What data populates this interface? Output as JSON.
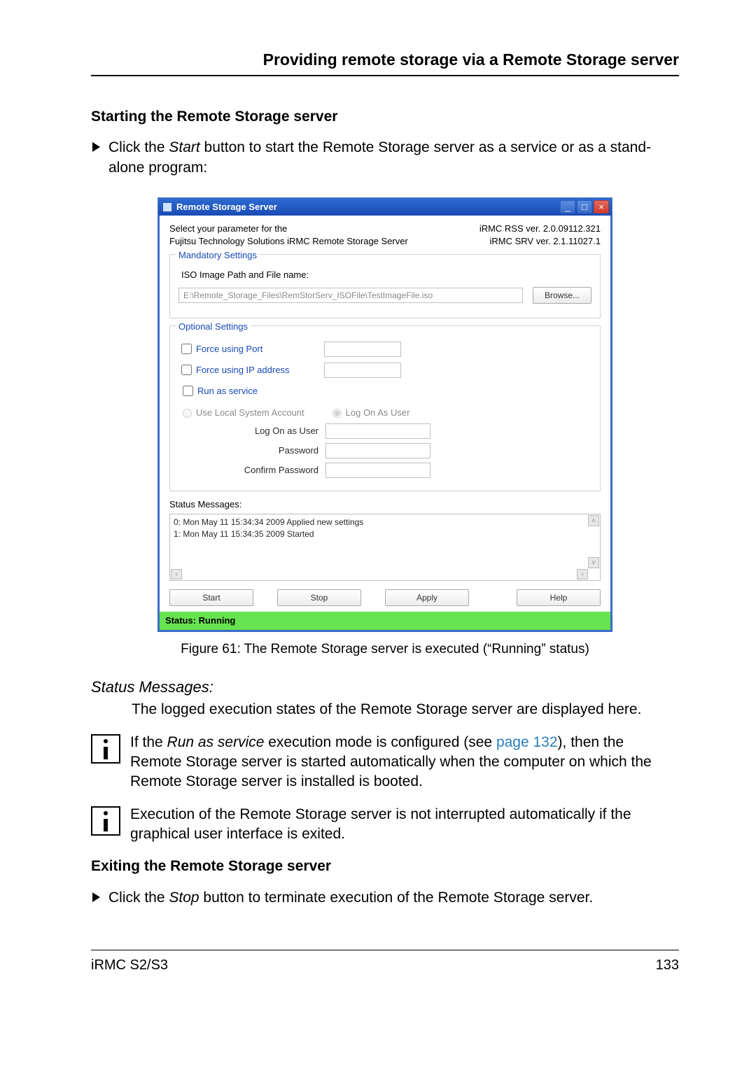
{
  "page": {
    "header": "Providing remote storage via a Remote Storage server",
    "section_start_title": "Starting the Remote Storage server",
    "step_start_prefix": "Click the ",
    "step_start_button": "Start",
    "step_start_suffix": " button to start the Remote Storage server as a service or as a stand-alone program:",
    "figure_caption": "Figure 61:  The Remote Storage server is executed (“Running” status)",
    "def_term": "Status Messages:",
    "def_body": "The logged execution states of the Remote Storage server are displayed here.",
    "info1_prefix": "If the ",
    "info1_mode": "Run as service",
    "info1_mid": " execution mode is configured (see ",
    "info1_link": "page 132",
    "info1_suffix": "), then the Remote Storage server is started automatically when the computer on which the Remote Storage server is installed is booted.",
    "info2": "Execution of the Remote Storage server is not interrupted automatically if the graphical user interface is exited.",
    "section_exit_title": "Exiting the Remote Storage server",
    "step_exit_prefix": "Click the ",
    "step_exit_button": "Stop",
    "step_exit_suffix": " button to terminate execution of the Remote Storage server.",
    "footer_left": "iRMC S2/S3",
    "footer_right": "133"
  },
  "dialog": {
    "title": "Remote Storage Server",
    "intro1": "Select your parameter for the",
    "intro2": "Fujitsu Technology Solutions iRMC Remote Storage Server",
    "ver1": "iRMC RSS ver. 2.0.09112.321",
    "ver2": "iRMC SRV ver. 2.1.11027.1",
    "mandatory_legend": "Mandatory Settings",
    "iso_label": "ISO Image Path and File name:",
    "iso_path_value": "E:\\Remote_Storage_Files\\RemStorServ_ISOFile\\TestImageFile.iso",
    "browse_label": "Browse...",
    "optional_legend": "Optional Settings",
    "force_port": "Force using Port",
    "force_ip": "Force using IP address",
    "run_service": "Run as service",
    "radio_local": "Use Local System Account",
    "radio_user": "Log On As User",
    "cred_user": "Log On as User",
    "cred_pass": "Password",
    "cred_conf": "Confirm Password",
    "status_label": "Status Messages:",
    "log_line1": "0: Mon May 11 15:34:34 2009 Applied new settings",
    "log_line2": "1: Mon May 11 15:34:35 2009 Started",
    "btn_start": "Start",
    "btn_stop": "Stop",
    "btn_apply": "Apply",
    "btn_help": "Help",
    "status_bar": "Status: Running"
  }
}
